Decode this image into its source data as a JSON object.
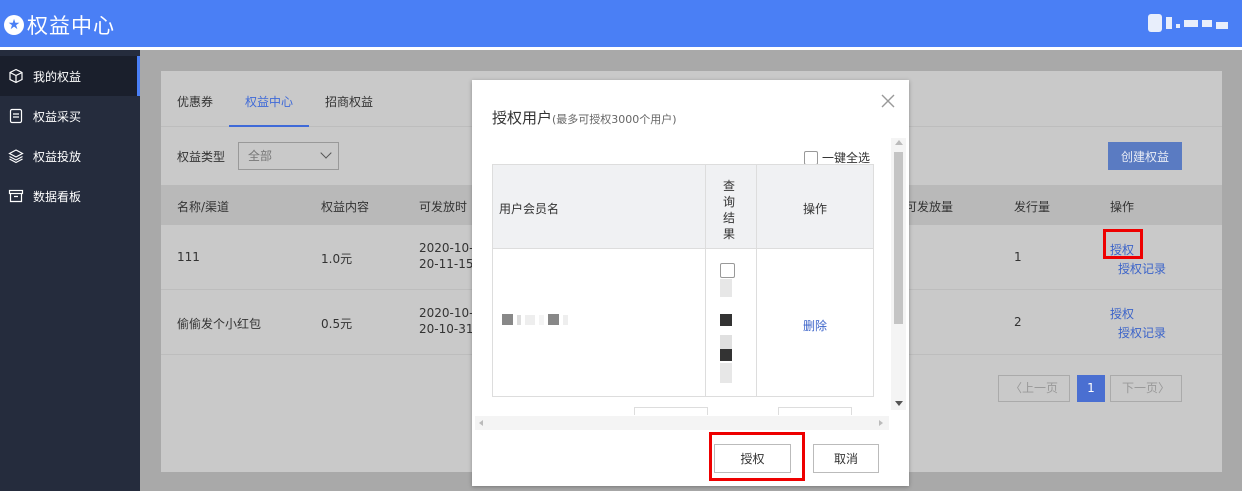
{
  "header": {
    "title": "权益中心",
    "logo_icon": "star-icon"
  },
  "sidebar": {
    "items": [
      {
        "label": "我的权益",
        "icon": "cube-icon",
        "active": true
      },
      {
        "label": "权益采买",
        "icon": "document-icon"
      },
      {
        "label": "权益投放",
        "icon": "layers-icon"
      },
      {
        "label": "数据看板",
        "icon": "archive-icon"
      }
    ]
  },
  "main": {
    "tabs": [
      "优惠券",
      "权益中心",
      "招商权益"
    ],
    "active_tab": "权益中心",
    "filter": {
      "label": "权益类型",
      "value": "全部"
    },
    "create_button": "创建权益",
    "table": {
      "headers": [
        "名称/渠道",
        "权益内容",
        "可发放时间",
        "可发放量",
        "发行量",
        "操作"
      ],
      "headers_visible": [
        "名称/渠道",
        "权益内容",
        "可发放时",
        "可发放量",
        "发行量",
        "操作"
      ],
      "rows": [
        {
          "name": "111",
          "content": "1.0元",
          "time1": "2020-10-",
          "time2": "20-11-15",
          "issued": "1",
          "action1": "授权",
          "action2": "授权记录"
        },
        {
          "name": "偷偷发个小红包",
          "content": "0.5元",
          "time1": "2020-10-",
          "time2": "20-10-31",
          "issued": "2",
          "action1": "授权",
          "action2": "授权记录"
        }
      ]
    },
    "pagination": {
      "prev": "上一页",
      "page": "1",
      "next": "下一页"
    }
  },
  "modal": {
    "title": "授权用户",
    "subtitle": "(最多可授权3000个用户)",
    "select_all": "一键全选",
    "columns": {
      "username": "用户会员名",
      "query_result": "查询结果",
      "action": "操作"
    },
    "row": {
      "action": "删除"
    },
    "grant_button": "授权",
    "cancel_button": "取消"
  },
  "colors": {
    "accent": "#4a7ff5",
    "sidebar": "#252c3d",
    "highlight": "#ee0000"
  }
}
